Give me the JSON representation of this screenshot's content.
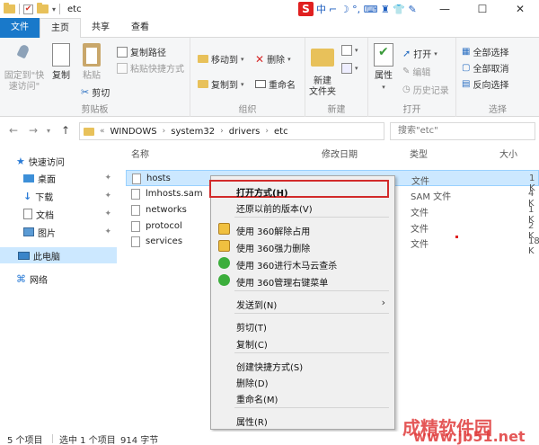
{
  "window": {
    "title": "etc",
    "min_glyph": "—",
    "max_glyph": "☐",
    "close_glyph": "✕"
  },
  "ime": {
    "logo": "S",
    "mode": "中",
    "extra": "⌐ ☽ °, ⌨ ♜ 👕 ✎"
  },
  "tabs": [
    {
      "label": "文件"
    },
    {
      "label": "主页"
    },
    {
      "label": "共享"
    },
    {
      "label": "查看"
    }
  ],
  "ribbon": {
    "pin_label_1": "固定到\"快",
    "pin_label_2": "速访问\"",
    "copy_label": "复制",
    "paste_label": "粘贴",
    "copy_path": "复制路径",
    "paste_shortcut": "粘贴快捷方式",
    "cut": "剪切",
    "clipboard_group": "剪贴板",
    "move_to": "移动到",
    "copy_to": "复制到",
    "delete": "删除",
    "rename": "重命名",
    "organize_group": "组织",
    "new_folder_1": "新建",
    "new_folder_2": "文件夹",
    "new_group": "新建",
    "properties": "属性",
    "open": "打开",
    "edit": "编辑",
    "history": "历史记录",
    "open_group": "打开",
    "select_all": "全部选择",
    "select_none": "全部取消",
    "invert": "反向选择",
    "select_group": "选择"
  },
  "address": {
    "back": "←",
    "forward": "→",
    "up": "↑",
    "lead": "«",
    "crumbs": [
      "WINDOWS",
      "system32",
      "drivers",
      "etc"
    ],
    "search_placeholder": "搜索\"etc\""
  },
  "nav": {
    "quick_access": "快速访问",
    "desktop": "桌面",
    "downloads": "下载",
    "documents": "文档",
    "pictures": "图片",
    "this_pc": "此电脑",
    "network": "网络"
  },
  "columns": {
    "name": "名称",
    "modified": "修改日期",
    "type": "类型",
    "size": "大小"
  },
  "files": [
    {
      "name": "hosts",
      "type": "文件",
      "size": "1 K"
    },
    {
      "name": "lmhosts.sam",
      "type": "SAM 文件",
      "size": "4 K"
    },
    {
      "name": "networks",
      "type": "文件",
      "size": "1 K"
    },
    {
      "name": "protocol",
      "type": "文件",
      "size": "2 K"
    },
    {
      "name": "services",
      "type": "文件",
      "size": "18 K"
    }
  ],
  "context_menu": {
    "open_with": "打开方式(H)",
    "restore": "还原以前的版本(V)",
    "unlock360": "使用 360解除占用",
    "force_delete360": "使用 360强力删除",
    "scan360": "使用 360进行木马云查杀",
    "manage360": "使用 360管理右键菜单",
    "send_to": "发送到(N)",
    "cut": "剪切(T)",
    "copy": "复制(C)",
    "create_shortcut": "创建快捷方式(S)",
    "delete": "删除(D)",
    "rename": "重命名(M)",
    "properties": "属性(R)",
    "submenu_arrow": "›"
  },
  "status": {
    "items": "5 个项目",
    "selected": "选中 1 个项目",
    "size": "914 字节"
  },
  "watermark": {
    "line1": "成精软件园",
    "line2": "www.jb51.net"
  }
}
